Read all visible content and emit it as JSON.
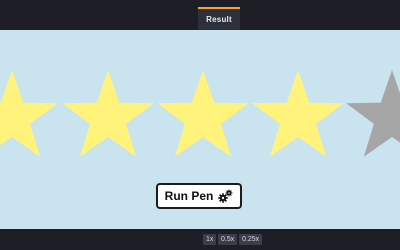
{
  "tabs": {
    "result_label": "Result"
  },
  "accent_color": "#ff9d2a",
  "stage": {
    "background": "#c9e4ef"
  },
  "rating": {
    "filled": 4,
    "star_color_filled": "#fff37c",
    "star_color_empty": "#a6a6a6"
  },
  "run_button": {
    "label": "Run Pen",
    "icon": "gears-icon"
  },
  "zoom": {
    "options": [
      "1x",
      "0.5x",
      "0.25x"
    ]
  }
}
